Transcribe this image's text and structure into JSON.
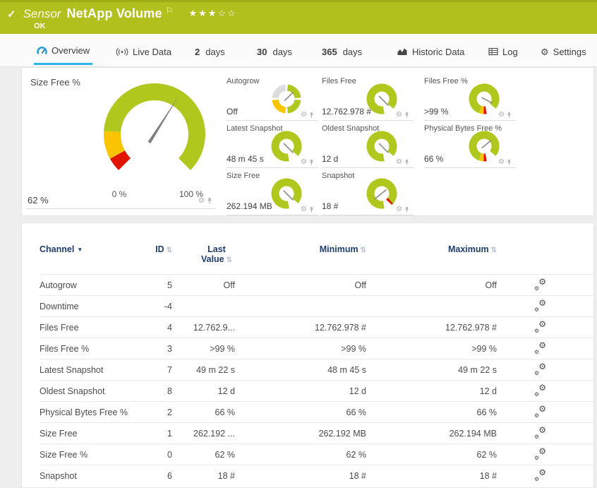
{
  "colors": {
    "header_green": "#b1c01d",
    "gauge_green": "#b0c81e",
    "gauge_yellow": "#fbc400",
    "gauge_red": "#e01400",
    "active_tab_underline": "#2eb4e9",
    "table_header_blue": "#1e3c6e"
  },
  "icons": {
    "check": "✓",
    "flag": "⚐",
    "gear": "⚙",
    "sort_both": "⇅",
    "sort_desc": "▼"
  },
  "header": {
    "type_label": "Sensor",
    "title": "NetApp Volume",
    "stars": "★★★☆☆",
    "status": "OK"
  },
  "tabs": {
    "overview": {
      "label": "Overview"
    },
    "live_data": {
      "label": "Live Data"
    },
    "d2": {
      "num": "2",
      "unit": "days"
    },
    "d30": {
      "num": "30",
      "unit": "days"
    },
    "d365": {
      "num": "365",
      "unit": "days"
    },
    "historic": {
      "label": "Historic Data"
    },
    "log": {
      "label": "Log"
    },
    "settings": {
      "label": "Settings"
    }
  },
  "overview": {
    "main_gauge": {
      "label": "Size Free %",
      "value": "62 %",
      "min_label": "0 %",
      "max_label": "100 %"
    },
    "tiles": [
      {
        "label": "Autogrow",
        "value": "Off"
      },
      {
        "label": "Files Free",
        "value": "12.762.978 #"
      },
      {
        "label": "Files Free %",
        "value": ">99 %"
      },
      {
        "label": "Latest Snapshot",
        "value": "48 m 45 s"
      },
      {
        "label": "Oldest Snapshot",
        "value": "12 d"
      },
      {
        "label": "Physical Bytes Free %",
        "value": "66 %"
      },
      {
        "label": "Size Free",
        "value": "262.194 MB"
      },
      {
        "label": "Snapshot",
        "value": "18 #"
      }
    ]
  },
  "table": {
    "columns": [
      {
        "label": "Channel"
      },
      {
        "label": "ID"
      },
      {
        "label": "Last Value"
      },
      {
        "label": "Minimum"
      },
      {
        "label": "Maximum"
      }
    ],
    "rows": [
      {
        "channel": "Autogrow",
        "id": "5",
        "last": "Off",
        "min": "Off",
        "max": "Off"
      },
      {
        "channel": "Downtime",
        "id": "-4",
        "last": "",
        "min": "",
        "max": ""
      },
      {
        "channel": "Files Free",
        "id": "4",
        "last": "12.762.9...",
        "min": "12.762.978 #",
        "max": "12.762.978 #"
      },
      {
        "channel": "Files Free %",
        "id": "3",
        "last": ">99 %",
        "min": ">99 %",
        "max": ">99 %"
      },
      {
        "channel": "Latest Snapshot",
        "id": "7",
        "last": "49 m 22 s",
        "min": "48 m 45 s",
        "max": "49 m 22 s"
      },
      {
        "channel": "Oldest Snapshot",
        "id": "8",
        "last": "12 d",
        "min": "12 d",
        "max": "12 d"
      },
      {
        "channel": "Physical Bytes Free %",
        "id": "2",
        "last": "66 %",
        "min": "66 %",
        "max": "66 %"
      },
      {
        "channel": "Size Free",
        "id": "1",
        "last": "262.192 ...",
        "min": "262.192 MB",
        "max": "262.194 MB"
      },
      {
        "channel": "Size Free %",
        "id": "0",
        "last": "62 %",
        "min": "62 %",
        "max": "62 %"
      },
      {
        "channel": "Snapshot",
        "id": "6",
        "last": "18 #",
        "min": "18 #",
        "max": "18 #"
      }
    ]
  }
}
